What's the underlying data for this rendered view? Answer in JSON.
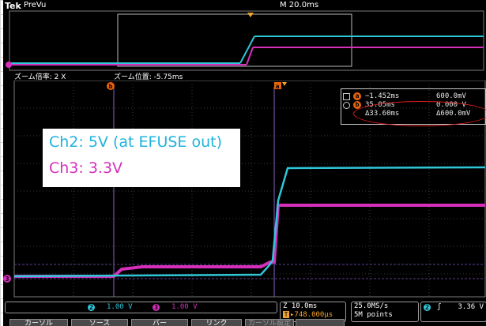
{
  "header": {
    "brand": "Tek",
    "status": "PreVu",
    "timebase": "M 20.0ms"
  },
  "zoom": {
    "factor_label": "ズーム倍率: 2 X",
    "position_label": "ズーム位置: -5.75ms"
  },
  "markers": {
    "trigger_symbol": "T",
    "cursor_a": "a",
    "cursor_b": "b",
    "ch3_ref": "3"
  },
  "overlay": {
    "line1": "Ch2: 5V (at EFUSE out)",
    "line2": "Ch3: 3.3V"
  },
  "cursors": {
    "a_time": "−1.452ms",
    "a_value": "600.0mV",
    "b_time": "35.05ms",
    "b_value": "0.000 V",
    "delta_time": "Δ33.60ms",
    "delta_value": "Δ600.0mV"
  },
  "channels": {
    "ch2": {
      "num": "2",
      "scale": "1.00 V",
      "color": "#2fc6d8"
    },
    "ch3": {
      "num": "3",
      "scale": "1.00 V",
      "color": "#d52fbc"
    }
  },
  "horizontal": {
    "scale": "Z 10.0ms",
    "delay_prefix": "T",
    "delay": "▸748.000µs"
  },
  "acquisition": {
    "rate": "25.0MS/s",
    "points": "5M points"
  },
  "trigger": {
    "source": "2",
    "slope": "ʃ",
    "level": "3.36 V"
  },
  "softkeys": [
    "カーソル",
    "ソース",
    "バー",
    "リンク",
    "カーソル設定",
    ""
  ],
  "colors": {
    "ch2": "#2fc6d8",
    "ch3": "#d52fbc",
    "cursor": "#e8630a",
    "annotation": "#e31c1c"
  }
}
